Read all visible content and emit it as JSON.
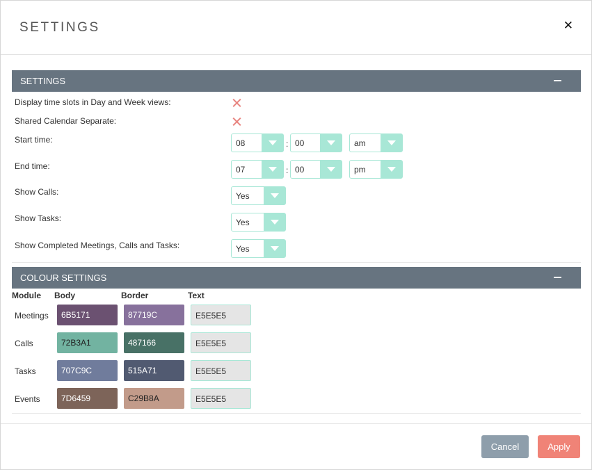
{
  "modal": {
    "title": "SETTINGS"
  },
  "settings_section": {
    "title": "SETTINGS",
    "labels": {
      "display_time_slots": "Display time slots in Day and Week views:",
      "shared_calendar_separate": "Shared Calendar Separate:",
      "start_time": "Start time:",
      "end_time": "End time:",
      "show_calls": "Show Calls:",
      "show_tasks": "Show Tasks:",
      "show_completed": "Show Completed Meetings, Calls and Tasks:"
    },
    "start_time": {
      "hour": "08",
      "minute": "00",
      "meridiem": "am"
    },
    "end_time": {
      "hour": "07",
      "minute": "00",
      "meridiem": "pm"
    },
    "show_calls": "Yes",
    "show_tasks": "Yes",
    "show_completed": "Yes",
    "colon": ":"
  },
  "colour_section": {
    "title": "COLOUR SETTINGS",
    "columns": {
      "module": "Module",
      "body": "Body",
      "border": "Border",
      "text": "Text"
    },
    "rows": [
      {
        "module": "Meetings",
        "body": "6B5171",
        "border": "87719C",
        "text": "E5E5E5"
      },
      {
        "module": "Calls",
        "body": "72B3A1",
        "border": "487166",
        "text": "E5E5E5"
      },
      {
        "module": "Tasks",
        "body": "707C9C",
        "border": "515A71",
        "text": "E5E5E5"
      },
      {
        "module": "Events",
        "body": "7D6459",
        "border": "C29B8A",
        "text": "E5E5E5"
      }
    ]
  },
  "footer": {
    "cancel_label": "Cancel",
    "apply_label": "Apply"
  },
  "colors": {
    "header_bar": "#677480",
    "select_accent": "#a8e7d6",
    "cancel": "#8e9eab",
    "apply": "#f08377"
  }
}
